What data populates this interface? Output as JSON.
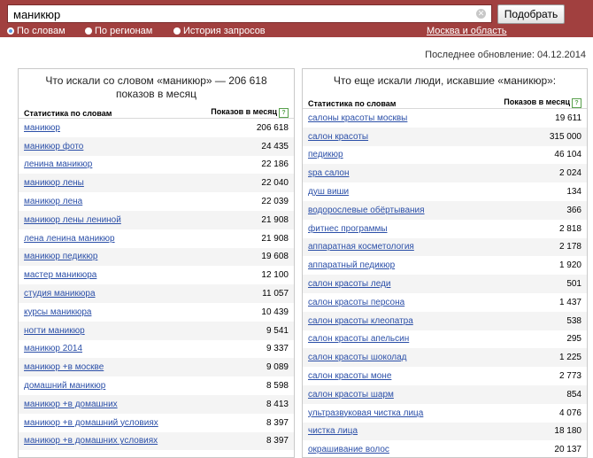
{
  "search": {
    "query": "маникюр",
    "button_label": "Подобрать"
  },
  "modes": [
    {
      "label": "По словам",
      "selected": true
    },
    {
      "label": "По регионам",
      "selected": false
    },
    {
      "label": "История запросов",
      "selected": false
    }
  ],
  "region": "Москва и область",
  "last_update": "Последнее обновление: 04.12.2014",
  "left_panel": {
    "title": "Что искали со словом «маникюр» — 206 618 показов в месяц",
    "col_phrase": "Статистика по словам",
    "col_count": "Показов в месяц",
    "help": "?",
    "rows": [
      {
        "phrase": "маникюр",
        "count": "206 618"
      },
      {
        "phrase": "маникюр фото",
        "count": "24 435"
      },
      {
        "phrase": "ленина маникюр",
        "count": "22 186"
      },
      {
        "phrase": "маникюр лены",
        "count": "22 040"
      },
      {
        "phrase": "маникюр лена",
        "count": "22 039"
      },
      {
        "phrase": "маникюр лены лениной",
        "count": "21 908"
      },
      {
        "phrase": "лена ленина маникюр",
        "count": "21 908"
      },
      {
        "phrase": "маникюр педикюр",
        "count": "19 608"
      },
      {
        "phrase": "мастер маникюра",
        "count": "12 100"
      },
      {
        "phrase": "студия маникюра",
        "count": "11 057"
      },
      {
        "phrase": "курсы маникюра",
        "count": "10 439"
      },
      {
        "phrase": "ногти маникюр",
        "count": "9 541"
      },
      {
        "phrase": "маникюр 2014",
        "count": "9 337"
      },
      {
        "phrase": "маникюр +в москве",
        "count": "9 089"
      },
      {
        "phrase": "домашний маникюр",
        "count": "8 598"
      },
      {
        "phrase": "маникюр +в домашних",
        "count": "8 413"
      },
      {
        "phrase": "маникюр +в домашний условиях",
        "count": "8 397"
      },
      {
        "phrase": "маникюр +в домашних условиях",
        "count": "8 397"
      }
    ]
  },
  "right_panel": {
    "title": "Что еще искали люди, искавшие «маникюр»:",
    "col_phrase": "Статистика по словам",
    "col_count": "Показов в месяц",
    "help": "?",
    "rows": [
      {
        "phrase": "салоны красоты москвы",
        "count": "19 611"
      },
      {
        "phrase": "салон красоты",
        "count": "315 000"
      },
      {
        "phrase": "педикюр",
        "count": "46 104"
      },
      {
        "phrase": "spa салон",
        "count": "2 024"
      },
      {
        "phrase": "душ виши",
        "count": "134"
      },
      {
        "phrase": "водорослевые обёртывания",
        "count": "366"
      },
      {
        "phrase": "фитнес программы",
        "count": "2 818"
      },
      {
        "phrase": "аппаратная косметология",
        "count": "2 178"
      },
      {
        "phrase": "аппаратный педикюр",
        "count": "1 920"
      },
      {
        "phrase": "салон красоты леди",
        "count": "501"
      },
      {
        "phrase": "салон красоты персона",
        "count": "1 437"
      },
      {
        "phrase": "салон красоты клеопатра",
        "count": "538"
      },
      {
        "phrase": "салон красоты апельсин",
        "count": "295"
      },
      {
        "phrase": "салон красоты шоколад",
        "count": "1 225"
      },
      {
        "phrase": "салон красоты моне",
        "count": "2 773"
      },
      {
        "phrase": "салон красоты шарм",
        "count": "854"
      },
      {
        "phrase": "ультразвуковая чистка лица",
        "count": "4 076"
      },
      {
        "phrase": "чистка лица",
        "count": "18 180"
      },
      {
        "phrase": "окрашивание волос",
        "count": "20 137"
      }
    ]
  }
}
